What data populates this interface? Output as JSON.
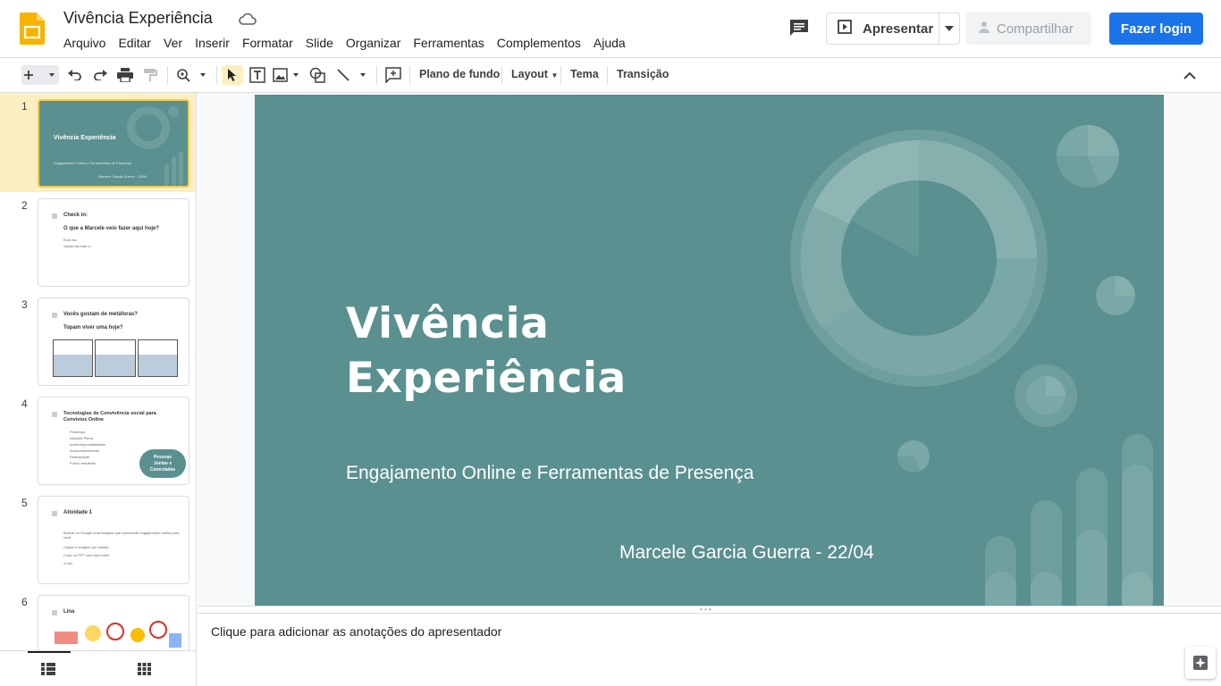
{
  "app": {
    "doc_title": "Vivência Experiência",
    "menu": [
      "Arquivo",
      "Editar",
      "Ver",
      "Inserir",
      "Formatar",
      "Slide",
      "Organizar",
      "Ferramentas",
      "Complementos",
      "Ajuda"
    ],
    "present_label": "Apresentar",
    "share_label": "Compartilhar",
    "login_label": "Fazer login",
    "brand_color": "#f4b400",
    "accent_color": "#1a73e8"
  },
  "toolbar": {
    "background_label": "Plano de fundo",
    "layout_label": "Layout",
    "theme_label": "Tema",
    "transition_label": "Transição"
  },
  "filmstrip": {
    "slides": [
      {
        "number": "1",
        "title": "Vivência Experiência",
        "subtitle": "Engajamento Online e Ferramentas de Presença",
        "author": "Marcele Garcia Guerra - 22/04"
      },
      {
        "number": "2",
        "title": "Check in:",
        "subtitle": "O que a Marcele veio fazer aqui hoje?",
        "lines": [
          "Ecks tov",
          "Saúda da mãe Li..."
        ]
      },
      {
        "number": "3",
        "title": "Vocês gostam de metáforas?",
        "subtitle": "Topam viver uma hoje?"
      },
      {
        "number": "4",
        "title": "Tecnologias de Convivência social para Convívios Online",
        "bullets": [
          "Presença",
          "Atenção Plena",
          "Autorresponsabilidade",
          "Autoconhecimento",
          "Participação",
          "Futuro resultado"
        ],
        "badge": "Pessoas Juntas e Conectadas"
      },
      {
        "number": "5",
        "title": "Atividade 1",
        "lines": [
          "Buscar no Google uma imagem que represente engajamento online para você",
          "Copiar a imagem (ou baixar)",
          "Colar no PPT com seu nome",
          "4 min"
        ]
      },
      {
        "number": "6",
        "title": "Lina"
      }
    ]
  },
  "slide": {
    "title_line1": "Vivência",
    "title_line2": "Experiência",
    "subtitle": "Engajamento Online e Ferramentas de Presença",
    "author": "Marcele Garcia Guerra - 22/04",
    "background_color": "#5a908f"
  },
  "notes": {
    "placeholder": "Clique para adicionar as anotações do apresentador"
  }
}
